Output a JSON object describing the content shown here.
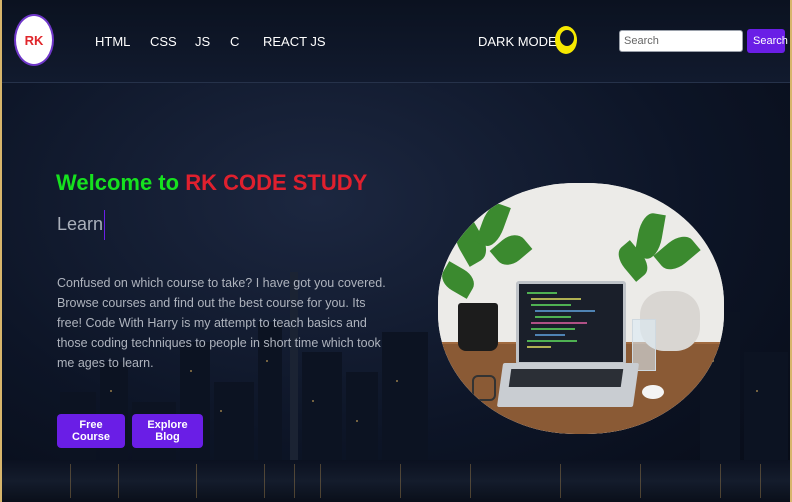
{
  "navbar": {
    "logo_text": "RK",
    "links": [
      "HTML",
      "CSS",
      "JS",
      "C",
      "REACT JS"
    ],
    "dark_mode_label": "DARK MODE",
    "moon_icon": "crescent-moon-icon",
    "search_placeholder": "Search",
    "search_button": "Search"
  },
  "hero": {
    "title_prefix": "Welcome to ",
    "title_brand": "RK CODE STUDY",
    "subtitle": "Learn",
    "description": "Confused on which course to take? I have got you covered. Browse courses and find out the best course for you. Its free! Code With Harry is my attempt to teach basics and those coding techniques to people in short time which took me ages to learn.",
    "buttons": [
      "Free Course",
      "Explore Blog"
    ]
  },
  "colors": {
    "accent": "#6a1ee6",
    "title_green": "#16e11f",
    "brand_red": "#e0202e",
    "moon_yellow": "#f5e800"
  }
}
